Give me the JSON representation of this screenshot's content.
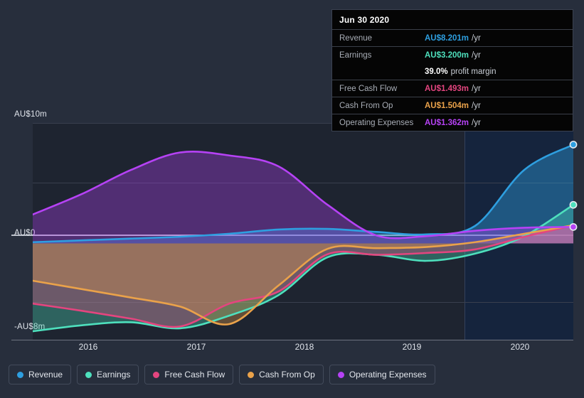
{
  "axes": {
    "y_labels": [
      "AU$10m",
      "AU$0",
      "-AU$8m"
    ],
    "x_labels": [
      "2016",
      "2017",
      "2018",
      "2019",
      "2020"
    ]
  },
  "tooltip": {
    "title": "Jun 30 2020",
    "rows": [
      {
        "key": "Revenue",
        "value": "AU$8.201m",
        "unit": "/yr",
        "color": "#2e9fe0"
      },
      {
        "key": "Earnings",
        "value": "AU$3.200m",
        "unit": "/yr",
        "color": "#4ee0bd"
      },
      {
        "key": "",
        "value": "39.0%",
        "unit": "profit margin",
        "color": "#ffffff"
      },
      {
        "key": "Free Cash Flow",
        "value": "AU$1.493m",
        "unit": "/yr",
        "color": "#e4457f"
      },
      {
        "key": "Cash From Op",
        "value": "AU$1.504m",
        "unit": "/yr",
        "color": "#eaa24a"
      },
      {
        "key": "Operating Expenses",
        "value": "AU$1.362m",
        "unit": "/yr",
        "color": "#b642f5"
      }
    ]
  },
  "legend": {
    "items": [
      {
        "label": "Revenue",
        "color": "#2e9fe0"
      },
      {
        "label": "Earnings",
        "color": "#4ee0bd"
      },
      {
        "label": "Free Cash Flow",
        "color": "#e4457f"
      },
      {
        "label": "Cash From Op",
        "color": "#eaa24a"
      },
      {
        "label": "Operating Expenses",
        "color": "#b642f5"
      }
    ]
  },
  "chart_data": {
    "type": "area",
    "title": "",
    "xlabel": "",
    "ylabel": "AU$",
    "currency": "AU$",
    "unit": "m",
    "ylim": [
      -8,
      10
    ],
    "yticks": [
      10,
      5,
      0,
      -5,
      -8
    ],
    "ytick_labels": [
      "AU$10m",
      "",
      "AU$0",
      "",
      "-AU$8m"
    ],
    "grid": true,
    "legend_position": "bottom",
    "x": [
      "2015.5",
      "2016.0",
      "2016.5",
      "2017.0",
      "2017.5",
      "2018.0",
      "2018.5",
      "2019.0",
      "2019.5",
      "2020.0",
      "2020.5"
    ],
    "x_tick_values": [
      "2016",
      "2017",
      "2018",
      "2019",
      "2020"
    ],
    "forecast_start": "2019.75",
    "forecast_shaded": true,
    "series": [
      {
        "name": "Revenue",
        "color": "#2e9fe0",
        "values": [
          0.1,
          0.25,
          0.4,
          0.55,
          0.8,
          1.15,
          1.2,
          0.95,
          0.75,
          1.45,
          6.1,
          8.201
        ]
      },
      {
        "name": "Earnings",
        "color": "#4ee0bd",
        "values": [
          -7.3,
          -6.8,
          -6.55,
          -7.05,
          -6.0,
          -4.3,
          -1.15,
          -0.95,
          -1.45,
          -0.85,
          0.6,
          3.2
        ]
      },
      {
        "name": "Free Cash Flow",
        "color": "#e4457f",
        "values": [
          -5.0,
          -5.6,
          -6.25,
          -6.9,
          -5.0,
          -4.0,
          -0.9,
          -0.95,
          -0.8,
          -0.5,
          0.55,
          1.493
        ]
      },
      {
        "name": "Cash From Op",
        "color": "#eaa24a",
        "values": [
          -3.1,
          -3.8,
          -4.5,
          -5.25,
          -6.7,
          -3.5,
          -0.45,
          -0.4,
          -0.3,
          0.1,
          0.8,
          1.504
        ]
      },
      {
        "name": "Operating Expenses",
        "color": "#b642f5",
        "values": [
          2.4,
          4.1,
          6.1,
          7.55,
          7.3,
          6.4,
          3.2,
          0.65,
          0.6,
          1.05,
          1.3,
          1.362
        ]
      }
    ],
    "endpoint_markers": [
      {
        "series": "Revenue",
        "value": 8.201
      },
      {
        "series": "Earnings",
        "value": 3.2
      },
      {
        "series": "Operating Expenses",
        "value": 1.362
      }
    ]
  }
}
